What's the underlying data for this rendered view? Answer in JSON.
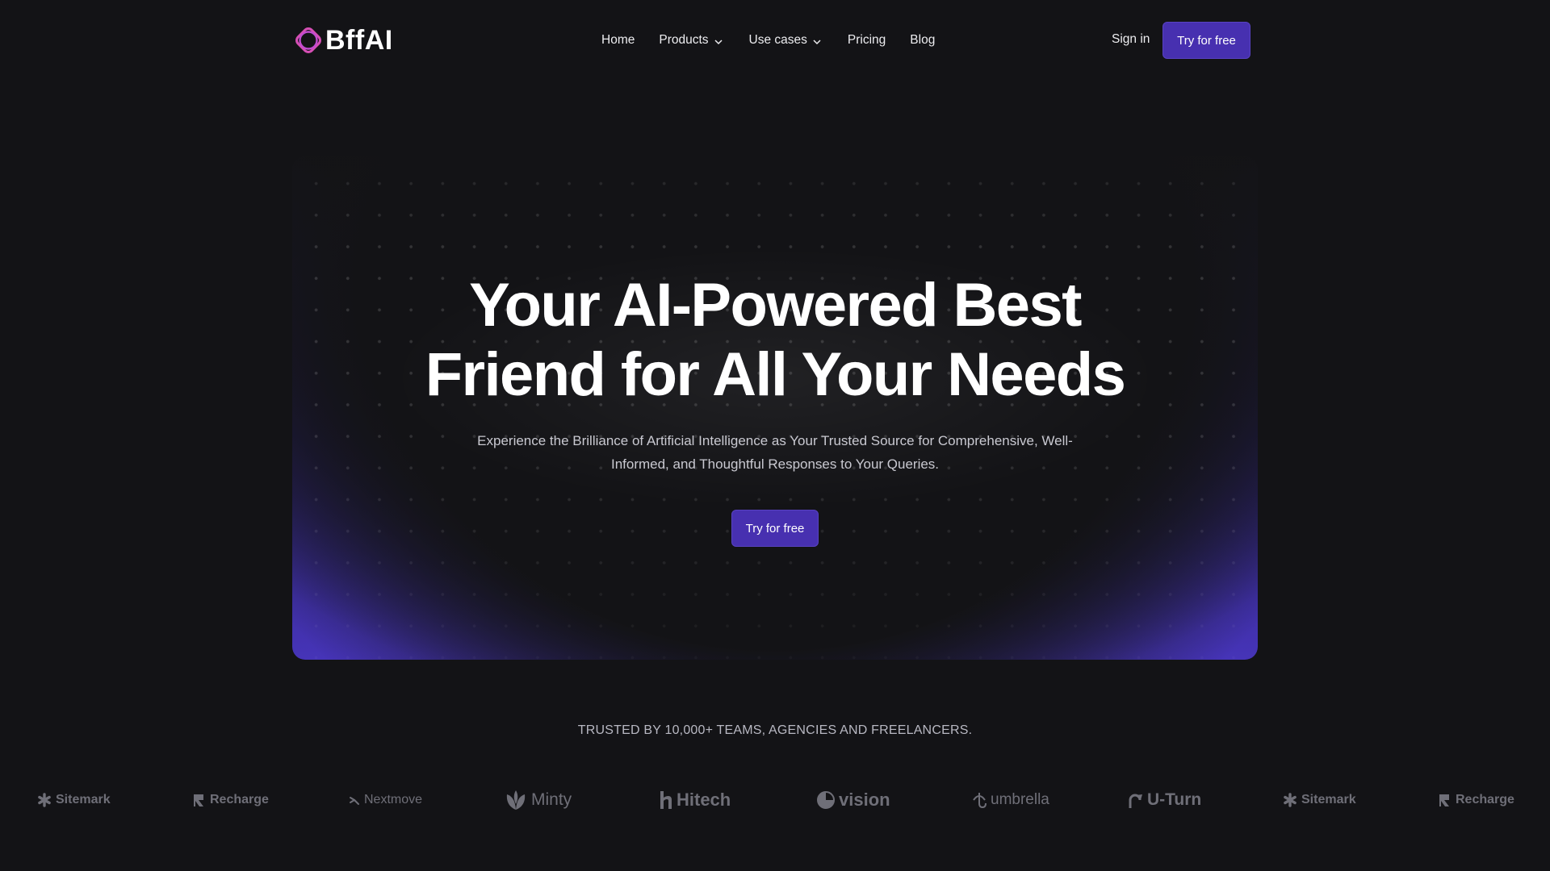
{
  "brand": {
    "name": "BffAI",
    "accent": "#4730b0",
    "logo_color": "#d64fb5"
  },
  "nav": {
    "home": "Home",
    "products": "Products",
    "use_cases": "Use cases",
    "pricing": "Pricing",
    "blog": "Blog",
    "sign_in": "Sign in",
    "cta": "Try for free"
  },
  "hero": {
    "title_line1": "Your AI-Powered Best",
    "title_line2": "Friend for All Your Needs",
    "subtitle": "Experience the Brilliance of Artificial Intelligence as Your Trusted Source for Comprehensive, Well-Informed, and Thoughtful Responses to Your Queries.",
    "cta": "Try for free"
  },
  "trusted": {
    "heading": "TRUSTED BY 10,000+ TEAMS, AGENCIES AND FREELANCERS.",
    "logos": [
      {
        "name": "Sitemark",
        "icon": "asterisk-icon"
      },
      {
        "name": "Recharge",
        "icon": "recharge-icon"
      },
      {
        "name": "Nextmove",
        "icon": "nextmove-icon"
      },
      {
        "name": "Minty",
        "icon": "leaf-icon"
      },
      {
        "name": "Hitech",
        "icon": "h-icon"
      },
      {
        "name": "vision",
        "icon": "circle-icon"
      },
      {
        "name": "umbrella",
        "icon": "umbrella-icon"
      },
      {
        "name": "U-Turn",
        "icon": "uturn-icon"
      },
      {
        "name": "Sitemark",
        "icon": "asterisk-icon"
      },
      {
        "name": "Recharge",
        "icon": "recharge-icon"
      }
    ]
  }
}
